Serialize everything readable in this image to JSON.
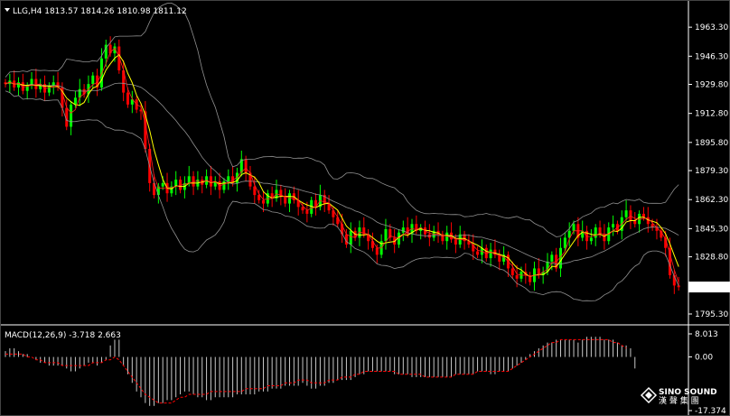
{
  "header": {
    "symbol_line": "LLG,H4  1813.57 1814.26 1810.98 1811.12",
    "macd_line": "MACD(12,26,9) -3.718 2.663"
  },
  "price_axis": {
    "ticks": [
      1963.3,
      1946.3,
      1929.8,
      1912.8,
      1895.8,
      1879.3,
      1862.3,
      1845.3,
      1828.8,
      1811.8,
      1795.3
    ],
    "tick_labels": [
      "1963.30",
      "1946.30",
      "1929.80",
      "1912.80",
      "1895.80",
      "1879.30",
      "1862.30",
      "1845.30",
      "1828.80",
      "1811.80",
      "1795.30"
    ],
    "current_price_label": "1811.12",
    "current_price": 1811.12,
    "range": [
      1790,
      1975
    ]
  },
  "macd_axis": {
    "tick_labels": [
      "8.013",
      "0.00",
      "-17.374"
    ],
    "ticks": [
      8.013,
      0.0,
      -17.374
    ]
  },
  "watermark": {
    "brand": "SINO SOUND",
    "sub": "漢 聲 集 團"
  },
  "colors": {
    "background": "#000000",
    "bull": "#00ff00",
    "bear": "#ff0000",
    "ma": "#ffff00",
    "ma_slow": "#ff2222",
    "bands": "#909090",
    "macd_hist": "#c8c8c8",
    "signal": "#ff0000",
    "axis": "#ffffff"
  },
  "chart_data": {
    "type": "candlestick",
    "series_close": [
      1930,
      1932,
      1928,
      1931,
      1926,
      1929,
      1933,
      1927,
      1930,
      1925,
      1929,
      1931,
      1928,
      1916,
      1905,
      1918,
      1922,
      1927,
      1924,
      1930,
      1935,
      1928,
      1945,
      1953,
      1948,
      1952,
      1938,
      1925,
      1918,
      1921,
      1915,
      1914,
      1892,
      1872,
      1865,
      1870,
      1872,
      1866,
      1870,
      1874,
      1868,
      1872,
      1876,
      1870,
      1874,
      1871,
      1876,
      1870,
      1873,
      1868,
      1873,
      1876,
      1872,
      1878,
      1886,
      1878,
      1870,
      1865,
      1862,
      1860,
      1866,
      1863,
      1868,
      1864,
      1860,
      1866,
      1862,
      1858,
      1856,
      1854,
      1862,
      1858,
      1865,
      1860,
      1856,
      1852,
      1848,
      1842,
      1836,
      1844,
      1840,
      1846,
      1842,
      1838,
      1834,
      1830,
      1838,
      1845,
      1840,
      1836,
      1843,
      1846,
      1842,
      1848,
      1844,
      1846,
      1842,
      1840,
      1844,
      1842,
      1838,
      1843,
      1839,
      1836,
      1842,
      1838,
      1836,
      1832,
      1830,
      1834,
      1828,
      1833,
      1830,
      1826,
      1830,
      1822,
      1818,
      1816,
      1820,
      1818,
      1814,
      1822,
      1818,
      1820,
      1826,
      1830,
      1822,
      1834,
      1840,
      1844,
      1848,
      1840,
      1844,
      1838,
      1840,
      1846,
      1842,
      1838,
      1846,
      1848,
      1844,
      1852,
      1856,
      1850,
      1848,
      1854,
      1852,
      1848,
      1846,
      1844,
      1840,
      1834,
      1818,
      1812,
      1811
    ],
    "macd_hist": [
      2,
      3,
      3,
      2,
      1,
      1,
      0,
      -1,
      -2,
      -2,
      -3,
      -3,
      -3,
      -3,
      -4,
      -5,
      -5,
      -4,
      -3,
      -2,
      -2,
      -3,
      -2,
      -1,
      4,
      6,
      6,
      -3,
      -6,
      -9,
      -12,
      -14,
      -16,
      -17,
      -17,
      -16,
      -16,
      -15,
      -15,
      -14,
      -13,
      -12,
      -12,
      -13,
      -14,
      -14,
      -15,
      -15,
      -14,
      -14,
      -14,
      -14,
      -14,
      -13,
      -13,
      -13,
      -13,
      -13,
      -12,
      -12,
      -12,
      -11,
      -11,
      -11,
      -10,
      -10,
      -10,
      -10,
      -9,
      -10,
      -11,
      -11,
      -10,
      -10,
      -9,
      -9,
      -8,
      -8,
      -8,
      -8,
      -7,
      -6,
      -6,
      -5,
      -5,
      -5,
      -5,
      -5,
      -5,
      -6,
      -6,
      -6,
      -6,
      -7,
      -7,
      -7,
      -7,
      -7,
      -7,
      -7,
      -7,
      -7,
      -7,
      -6,
      -6,
      -6,
      -6,
      -6,
      -5,
      -5,
      -5,
      -6,
      -6,
      -5,
      -5,
      -5,
      -4,
      -3,
      -2,
      -1,
      1,
      2,
      3,
      4,
      5,
      5,
      6,
      6,
      6,
      6,
      6,
      5,
      6,
      7,
      7,
      7,
      7,
      6,
      6,
      6,
      5,
      4,
      4,
      3,
      -4
    ],
    "signal": [
      1,
      1,
      1,
      1,
      1,
      0,
      0,
      -1,
      -1,
      -2,
      -2,
      -2,
      -2,
      -3,
      -3,
      -3,
      -3,
      -3,
      -3,
      -3,
      -2,
      -2,
      -2,
      -1,
      -1,
      0,
      -1,
      -3,
      -5,
      -7,
      -9,
      -11,
      -13,
      -14,
      -15,
      -16,
      -16,
      -16,
      -16,
      -15,
      -14,
      -14,
      -13,
      -13,
      -13,
      -13,
      -13,
      -12,
      -12,
      -12,
      -12,
      -12,
      -12,
      -12,
      -12,
      -11,
      -11,
      -11,
      -11,
      -11,
      -10,
      -10,
      -10,
      -10,
      -9,
      -9,
      -9,
      -8,
      -8,
      -8,
      -9,
      -9,
      -9,
      -9,
      -8,
      -8,
      -8,
      -7,
      -7,
      -7,
      -6,
      -6,
      -5,
      -5,
      -5,
      -5,
      -5,
      -5,
      -5,
      -5,
      -6,
      -6,
      -6,
      -6,
      -6,
      -6,
      -7,
      -7,
      -7,
      -7,
      -7,
      -7,
      -7,
      -6,
      -6,
      -6,
      -6,
      -6,
      -5,
      -5,
      -5,
      -5,
      -5,
      -5,
      -5,
      -5,
      -4,
      -3,
      -2,
      -1,
      0,
      1,
      2,
      3,
      4,
      5,
      5,
      6,
      6,
      6,
      6,
      6,
      6,
      6,
      6,
      6,
      6,
      6,
      6,
      5,
      5,
      4,
      3
    ]
  }
}
